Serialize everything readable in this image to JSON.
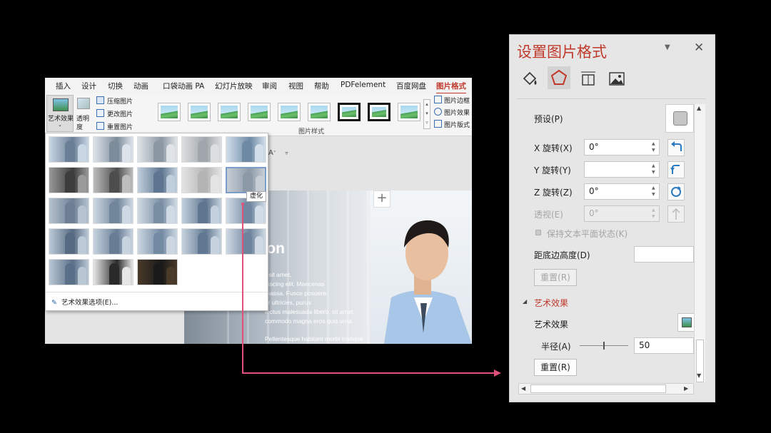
{
  "ribbon": {
    "tabs": [
      "插入",
      "设计",
      "切换",
      "动画",
      "口袋动画 PA",
      "幻灯片放映",
      "审阅",
      "视图",
      "帮助",
      "PDFelement",
      "百度网盘",
      "图片格式"
    ],
    "active_tab": "图片格式",
    "artistic_effects_label": "艺术效果",
    "transparency_label_1": "透明",
    "transparency_label_2": "度",
    "compress_label": "压缩图片",
    "change_label": "更改图片",
    "reset_label": "重置图片",
    "picture_styles_group": "图片样式",
    "border_label": "图片边框",
    "effects_label": "图片效果",
    "layout_label": "图片版式"
  },
  "effects_menu": {
    "tooltip": "虚化",
    "options_label": "艺术效果选项(E)..."
  },
  "slide": {
    "title_fragment": "iation",
    "body_lines": [
      "r sit amet,",
      "piscing elit. Maecenas",
      "massa. Fusce posuere,",
      "ar ultricies, purus",
      "lectus malesuada libero, sit amet",
      "commodo magna eros quis urna."
    ],
    "body_last": "Pellentesque habitant morbi tristique",
    "font_size_glyph": "A",
    "plus": "+"
  },
  "pane": {
    "title": "设置图片格式",
    "preset_label": "预设(P)",
    "x_rotation_label": "X 旋转(X)",
    "x_rotation_value": "0°",
    "y_rotation_label": "Y 旋转(Y)",
    "y_rotation_value": "",
    "z_rotation_label": "Z 旋转(Z)",
    "z_rotation_value": "0°",
    "perspective_label": "透视(E)",
    "perspective_value": "0°",
    "keep_flat_label": "保持文本平面状态(K)",
    "distance_label": "距底边高度(D)",
    "distance_value": "",
    "reset_label_1": "重置(R)",
    "section_title": "艺术效果",
    "artistic_effect_label": "艺术效果",
    "radius_label": "半径(A)",
    "radius_value": "50",
    "reset_label_2": "重置(R)"
  },
  "colors": {
    "accent": "#c0392b",
    "arrow": "#e0507a"
  }
}
